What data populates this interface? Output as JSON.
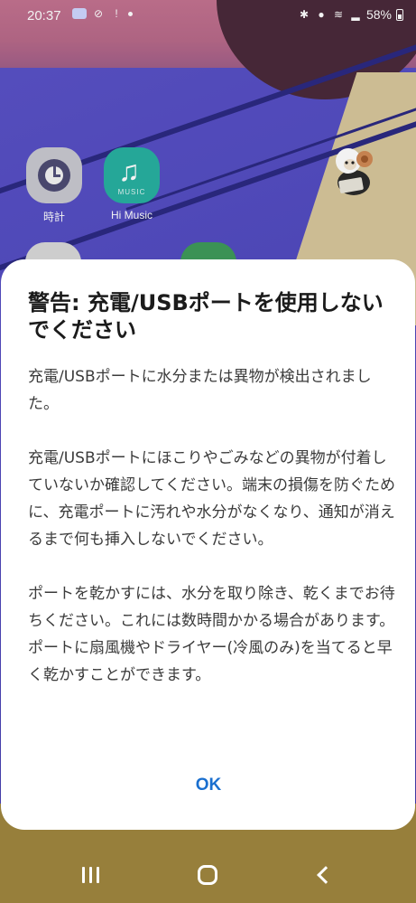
{
  "status_bar": {
    "time": "20:37",
    "battery": "58%"
  },
  "home_apps": [
    {
      "label": "時計",
      "icon": "clock-icon"
    },
    {
      "label": "Hi Music",
      "icon": "music-icon",
      "icon_text": "MUSIC"
    }
  ],
  "dialog": {
    "title": "警告: 充電/USBポートを使用しないでください",
    "paragraphs": [
      "充電/USBポートに水分または異物が検出されました。",
      "充電/USBポートにほこりやごみなどの異物が付着していないか確認してください。端末の損傷を防ぐために、充電ポートに汚れや水分がなくなり、通知が消えるまで何も挿入しないでください。",
      "ポートを乾かすには、水分を取り除き、乾くまでお待ちください。これには数時間かかる場合があります。ポートに扇風機やドライヤー(冷風のみ)を当てると早く乾かすことができます。"
    ],
    "ok_label": "OK"
  },
  "nav_bar": {
    "recents": "recents-icon",
    "home": "home-icon",
    "back": "back-icon"
  },
  "colors": {
    "accent": "#1a6fcf",
    "dialog_bg": "#ffffff",
    "title_text": "#1b1b1b",
    "body_text": "#3b3b3b"
  }
}
